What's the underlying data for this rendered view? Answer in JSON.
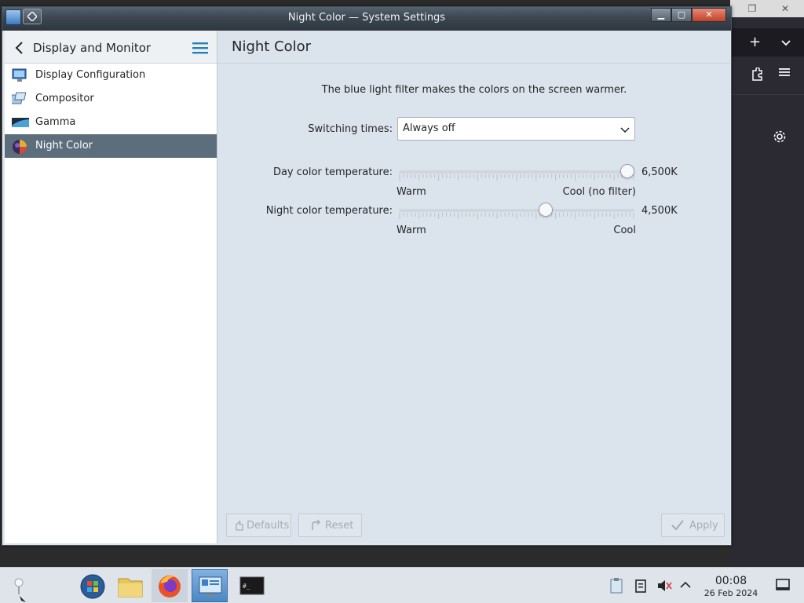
{
  "window": {
    "title": "Night Color — System Settings"
  },
  "sidebar": {
    "header_label": "Display and Monitor",
    "items": [
      {
        "label": "Display Configuration",
        "icon": "display-configuration-icon"
      },
      {
        "label": "Compositor",
        "icon": "compositor-icon"
      },
      {
        "label": "Gamma",
        "icon": "gamma-icon"
      },
      {
        "label": "Night Color",
        "icon": "night-color-icon",
        "active": true
      }
    ]
  },
  "main": {
    "title": "Night Color",
    "description": "The blue light filter makes the colors on the screen warmer.",
    "switching_label": "Switching times:",
    "switching_value": "Always off",
    "day": {
      "label": "Day color temperature:",
      "value": "6,500K",
      "level": 1.0,
      "min_label": "Warm",
      "max_label": "Cool (no filter)"
    },
    "night": {
      "label": "Night color temperature:",
      "value": "4,500K",
      "level": 0.63,
      "min_label": "Warm",
      "max_label": "Cool"
    },
    "buttons": {
      "defaults": "Defaults",
      "reset": "Reset",
      "apply": "Apply"
    }
  },
  "taskbar": {
    "clock_time": "00:08",
    "clock_date": "26 Feb 2024"
  },
  "colors": {
    "active_item": "#5c6e7c",
    "accent": "#3daee9"
  }
}
